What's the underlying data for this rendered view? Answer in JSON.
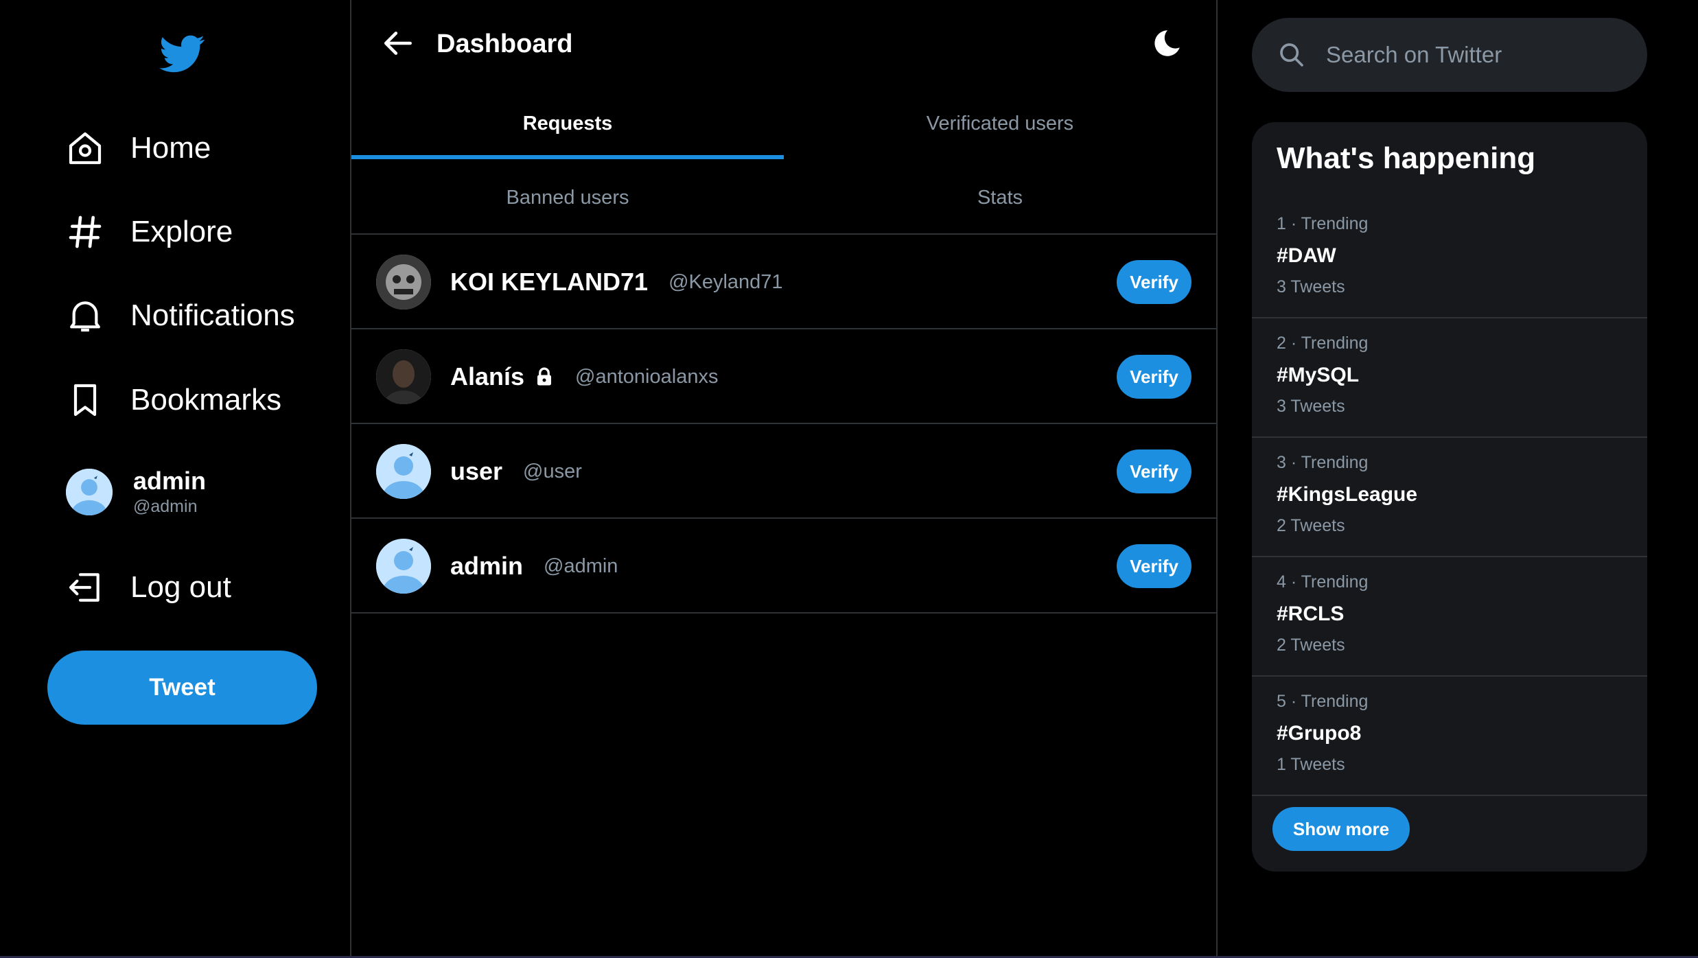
{
  "sidebar": {
    "items": [
      {
        "label": "Home",
        "icon": "home-icon"
      },
      {
        "label": "Explore",
        "icon": "hashtag-icon"
      },
      {
        "label": "Notifications",
        "icon": "bell-icon"
      },
      {
        "label": "Bookmarks",
        "icon": "bookmark-icon"
      }
    ],
    "profile": {
      "name": "admin",
      "handle": "@admin"
    },
    "logout_label": "Log out",
    "tweet_label": "Tweet"
  },
  "header": {
    "title": "Dashboard"
  },
  "tabs": [
    {
      "label": "Requests",
      "active": true
    },
    {
      "label": "Verificated users",
      "active": false
    },
    {
      "label": "Banned users",
      "active": false
    },
    {
      "label": "Stats",
      "active": false
    }
  ],
  "users": [
    {
      "name": "KOI KEYLAND71",
      "handle": "@Keyland71",
      "button": "Verify",
      "locked": false
    },
    {
      "name": "Alanís",
      "handle": "@antonioalanxs",
      "button": "Verify",
      "locked": true
    },
    {
      "name": "user",
      "handle": "@user",
      "button": "Verify",
      "locked": false
    },
    {
      "name": "admin",
      "handle": "@admin",
      "button": "Verify",
      "locked": false
    }
  ],
  "search": {
    "placeholder": "Search on Twitter"
  },
  "trends": {
    "title": "What's happening",
    "items": [
      {
        "meta": "1 · Trending",
        "tag": "#DAW",
        "count": "3 Tweets"
      },
      {
        "meta": "2 · Trending",
        "tag": "#MySQL",
        "count": "3 Tweets"
      },
      {
        "meta": "3 · Trending",
        "tag": "#KingsLeague",
        "count": "2 Tweets"
      },
      {
        "meta": "4 · Trending",
        "tag": "#RCLS",
        "count": "2 Tweets"
      },
      {
        "meta": "5 · Trending",
        "tag": "#Grupo8",
        "count": "1 Tweets"
      }
    ],
    "show_more_label": "Show more"
  },
  "colors": {
    "accent": "#1d8fe0",
    "background": "#000000",
    "panel": "#16181c",
    "muted": "#8b98a5"
  }
}
